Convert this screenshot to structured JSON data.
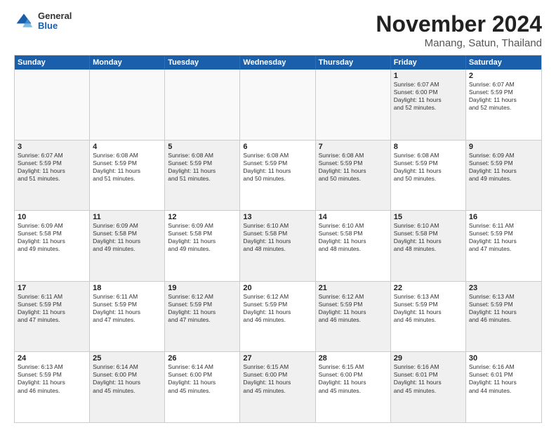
{
  "header": {
    "logo_general": "General",
    "logo_blue": "Blue",
    "title": "November 2024",
    "location": "Manang, Satun, Thailand"
  },
  "weekdays": [
    "Sunday",
    "Monday",
    "Tuesday",
    "Wednesday",
    "Thursday",
    "Friday",
    "Saturday"
  ],
  "rows": [
    [
      {
        "day": "",
        "info": "",
        "empty": true
      },
      {
        "day": "",
        "info": "",
        "empty": true
      },
      {
        "day": "",
        "info": "",
        "empty": true
      },
      {
        "day": "",
        "info": "",
        "empty": true
      },
      {
        "day": "",
        "info": "",
        "empty": true
      },
      {
        "day": "1",
        "info": "Sunrise: 6:07 AM\nSunset: 6:00 PM\nDaylight: 11 hours\nand 52 minutes.",
        "shaded": true
      },
      {
        "day": "2",
        "info": "Sunrise: 6:07 AM\nSunset: 5:59 PM\nDaylight: 11 hours\nand 52 minutes.",
        "shaded": false
      }
    ],
    [
      {
        "day": "3",
        "info": "Sunrise: 6:07 AM\nSunset: 5:59 PM\nDaylight: 11 hours\nand 51 minutes.",
        "shaded": true
      },
      {
        "day": "4",
        "info": "Sunrise: 6:08 AM\nSunset: 5:59 PM\nDaylight: 11 hours\nand 51 minutes.",
        "shaded": false
      },
      {
        "day": "5",
        "info": "Sunrise: 6:08 AM\nSunset: 5:59 PM\nDaylight: 11 hours\nand 51 minutes.",
        "shaded": true
      },
      {
        "day": "6",
        "info": "Sunrise: 6:08 AM\nSunset: 5:59 PM\nDaylight: 11 hours\nand 50 minutes.",
        "shaded": false
      },
      {
        "day": "7",
        "info": "Sunrise: 6:08 AM\nSunset: 5:59 PM\nDaylight: 11 hours\nand 50 minutes.",
        "shaded": true
      },
      {
        "day": "8",
        "info": "Sunrise: 6:08 AM\nSunset: 5:59 PM\nDaylight: 11 hours\nand 50 minutes.",
        "shaded": false
      },
      {
        "day": "9",
        "info": "Sunrise: 6:09 AM\nSunset: 5:59 PM\nDaylight: 11 hours\nand 49 minutes.",
        "shaded": true
      }
    ],
    [
      {
        "day": "10",
        "info": "Sunrise: 6:09 AM\nSunset: 5:58 PM\nDaylight: 11 hours\nand 49 minutes.",
        "shaded": false
      },
      {
        "day": "11",
        "info": "Sunrise: 6:09 AM\nSunset: 5:58 PM\nDaylight: 11 hours\nand 49 minutes.",
        "shaded": true
      },
      {
        "day": "12",
        "info": "Sunrise: 6:09 AM\nSunset: 5:58 PM\nDaylight: 11 hours\nand 49 minutes.",
        "shaded": false
      },
      {
        "day": "13",
        "info": "Sunrise: 6:10 AM\nSunset: 5:58 PM\nDaylight: 11 hours\nand 48 minutes.",
        "shaded": true
      },
      {
        "day": "14",
        "info": "Sunrise: 6:10 AM\nSunset: 5:58 PM\nDaylight: 11 hours\nand 48 minutes.",
        "shaded": false
      },
      {
        "day": "15",
        "info": "Sunrise: 6:10 AM\nSunset: 5:58 PM\nDaylight: 11 hours\nand 48 minutes.",
        "shaded": true
      },
      {
        "day": "16",
        "info": "Sunrise: 6:11 AM\nSunset: 5:59 PM\nDaylight: 11 hours\nand 47 minutes.",
        "shaded": false
      }
    ],
    [
      {
        "day": "17",
        "info": "Sunrise: 6:11 AM\nSunset: 5:59 PM\nDaylight: 11 hours\nand 47 minutes.",
        "shaded": true
      },
      {
        "day": "18",
        "info": "Sunrise: 6:11 AM\nSunset: 5:59 PM\nDaylight: 11 hours\nand 47 minutes.",
        "shaded": false
      },
      {
        "day": "19",
        "info": "Sunrise: 6:12 AM\nSunset: 5:59 PM\nDaylight: 11 hours\nand 47 minutes.",
        "shaded": true
      },
      {
        "day": "20",
        "info": "Sunrise: 6:12 AM\nSunset: 5:59 PM\nDaylight: 11 hours\nand 46 minutes.",
        "shaded": false
      },
      {
        "day": "21",
        "info": "Sunrise: 6:12 AM\nSunset: 5:59 PM\nDaylight: 11 hours\nand 46 minutes.",
        "shaded": true
      },
      {
        "day": "22",
        "info": "Sunrise: 6:13 AM\nSunset: 5:59 PM\nDaylight: 11 hours\nand 46 minutes.",
        "shaded": false
      },
      {
        "day": "23",
        "info": "Sunrise: 6:13 AM\nSunset: 5:59 PM\nDaylight: 11 hours\nand 46 minutes.",
        "shaded": true
      }
    ],
    [
      {
        "day": "24",
        "info": "Sunrise: 6:13 AM\nSunset: 5:59 PM\nDaylight: 11 hours\nand 46 minutes.",
        "shaded": false
      },
      {
        "day": "25",
        "info": "Sunrise: 6:14 AM\nSunset: 6:00 PM\nDaylight: 11 hours\nand 45 minutes.",
        "shaded": true
      },
      {
        "day": "26",
        "info": "Sunrise: 6:14 AM\nSunset: 6:00 PM\nDaylight: 11 hours\nand 45 minutes.",
        "shaded": false
      },
      {
        "day": "27",
        "info": "Sunrise: 6:15 AM\nSunset: 6:00 PM\nDaylight: 11 hours\nand 45 minutes.",
        "shaded": true
      },
      {
        "day": "28",
        "info": "Sunrise: 6:15 AM\nSunset: 6:00 PM\nDaylight: 11 hours\nand 45 minutes.",
        "shaded": false
      },
      {
        "day": "29",
        "info": "Sunrise: 6:16 AM\nSunset: 6:01 PM\nDaylight: 11 hours\nand 45 minutes.",
        "shaded": true
      },
      {
        "day": "30",
        "info": "Sunrise: 6:16 AM\nSunset: 6:01 PM\nDaylight: 11 hours\nand 44 minutes.",
        "shaded": false
      }
    ]
  ]
}
